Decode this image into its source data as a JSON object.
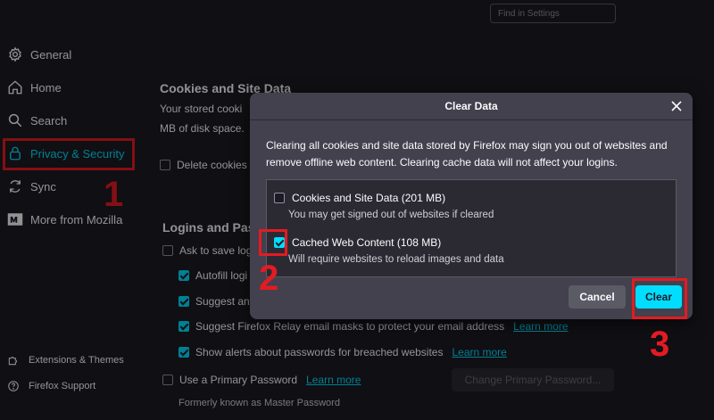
{
  "search": {
    "placeholder": "Find in Settings"
  },
  "sidebar": {
    "items": [
      {
        "label": "General",
        "icon": "gear-icon"
      },
      {
        "label": "Home",
        "icon": "home-icon"
      },
      {
        "label": "Search",
        "icon": "search-icon"
      },
      {
        "label": "Privacy & Security",
        "icon": "lock-icon",
        "selected": true
      },
      {
        "label": "Sync",
        "icon": "sync-icon"
      },
      {
        "label": "More from Mozilla",
        "icon": "mozilla-icon"
      }
    ],
    "footer": [
      {
        "label": "Extensions & Themes",
        "icon": "puzzle-icon"
      },
      {
        "label": "Firefox Support",
        "icon": "help-icon"
      }
    ]
  },
  "content": {
    "cookies_heading": "Cookies and Site Data",
    "cookies_text_1": "Your stored cooki",
    "cookies_text_2": "MB of disk space.",
    "delete_cookies": "Delete cookies",
    "logins_heading": "Logins and Pas",
    "ask_to_save": "Ask to save log",
    "autofill": "Autofill logi",
    "suggest": "Suggest an",
    "suggest_relay": "Suggest Firefox Relay email masks to protect your email address",
    "show_alerts": "Show alerts about passwords for breached websites",
    "use_primary": "Use a Primary Password",
    "learn_more": "Learn more",
    "change_primary": "Change Primary Password...",
    "formerly": "Formerly known as Master Password"
  },
  "dialog": {
    "title": "Clear Data",
    "description": "Clearing all cookies and site data stored by Firefox may sign you out of websites and remove offline web content. Clearing cache data will not affect your logins.",
    "options": [
      {
        "label": "Cookies and Site Data (201 MB)",
        "sub": "You may get signed out of websites if cleared",
        "checked": false
      },
      {
        "label": "Cached Web Content (108 MB)",
        "sub": "Will require websites to reload images and data",
        "checked": true
      }
    ],
    "cancel_label": "Cancel",
    "clear_label": "Clear"
  },
  "annotations": {
    "step1": "1",
    "step2": "2",
    "step3": "3"
  },
  "colors": {
    "accent": "#00ddff",
    "annotation": "#e31b23",
    "background": "#1c1b22",
    "dialog": "#42414d"
  }
}
